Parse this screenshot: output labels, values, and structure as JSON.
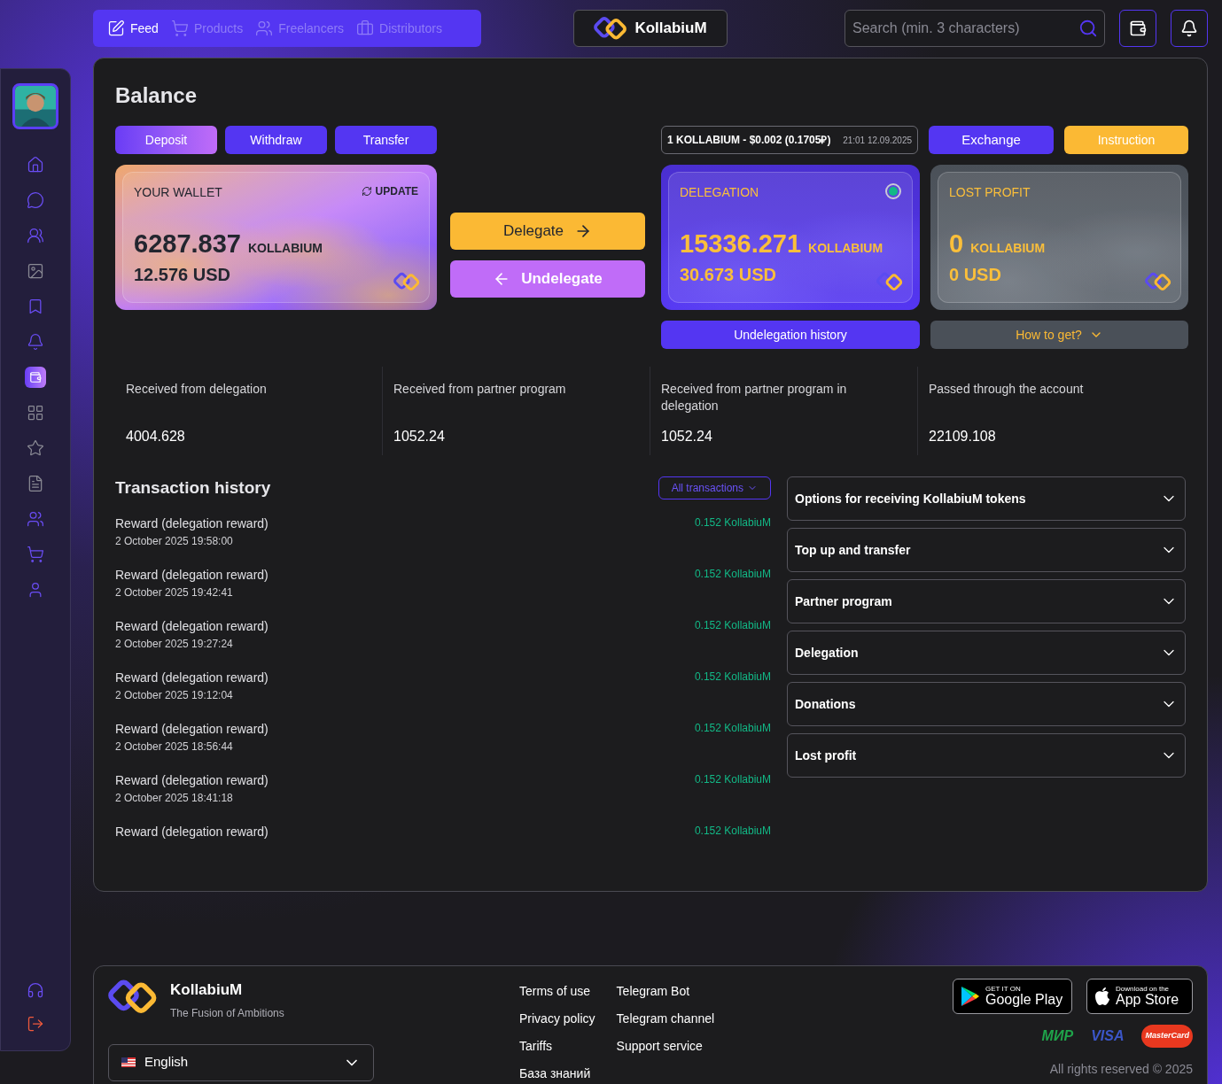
{
  "nav": {
    "tabs": [
      {
        "label": "Feed",
        "selected": true
      },
      {
        "label": "Products",
        "selected": false
      },
      {
        "label": "Freelancers",
        "selected": false
      },
      {
        "label": "Distributors",
        "selected": false
      }
    ],
    "logo": "KollabiuM",
    "search": {
      "placeholder": "Search (min. 3 characters)"
    }
  },
  "sidebar": {
    "items": [
      {
        "selected": false
      },
      {
        "selected": false
      },
      {
        "selected": false
      },
      {
        "selected": false
      },
      {
        "selected": false
      },
      {
        "selected": false
      },
      {
        "selected": true
      },
      {
        "selected": false
      },
      {
        "selected": false
      },
      {
        "selected": false
      },
      {
        "selected": false
      },
      {
        "selected": false
      },
      {
        "selected": false
      }
    ]
  },
  "balance": {
    "title": "Balance",
    "actions": [
      "Deposit",
      "Withdraw",
      "Transfer"
    ],
    "rate": "1 KOLLABIUM - $0.002 (0.1705₽)",
    "rate_time": "21:01 12.09.2025",
    "exchange": "Exchange",
    "instruction": "Instruction",
    "wallet": {
      "label": "YOUR WALLET",
      "update": "UPDATE",
      "amount": "6287.837",
      "unit": "KOLLABIUM",
      "usd": "12.576 USD"
    },
    "delegate": "Delegate",
    "undelegate": "Undelegate",
    "delegation": {
      "label": "DELEGATION",
      "active": true,
      "amount": "15336.271",
      "unit": "KOLLABIUM",
      "usd": "30.673 USD",
      "history": "Undelegation history"
    },
    "lost_profit": {
      "label": "LOST PROFIT",
      "amount": "0",
      "unit": "KOLLABIUM",
      "usd": "0 USD",
      "how": "How to get?"
    },
    "stats": [
      {
        "label": "Received from delegation",
        "value": "4004.628"
      },
      {
        "label": "Received from partner program",
        "value": "1052.24"
      },
      {
        "label": "Received from partner program in delegation",
        "value": "1052.24"
      },
      {
        "label": "Passed through the account",
        "value": "22109.108"
      }
    ]
  },
  "transactions": {
    "title": "Transaction history",
    "filter": "All transactions",
    "rows": [
      {
        "title": "Reward (delegation reward)",
        "date": "2 October 2025 19:58:00",
        "amount": "0.152 KollabiuM"
      },
      {
        "title": "Reward (delegation reward)",
        "date": "2 October 2025 19:42:41",
        "amount": "0.152 KollabiuM"
      },
      {
        "title": "Reward (delegation reward)",
        "date": "2 October 2025 19:27:24",
        "amount": "0.152 KollabiuM"
      },
      {
        "title": "Reward (delegation reward)",
        "date": "2 October 2025 19:12:04",
        "amount": "0.152 KollabiuM"
      },
      {
        "title": "Reward (delegation reward)",
        "date": "2 October 2025 18:56:44",
        "amount": "0.152 KollabiuM"
      },
      {
        "title": "Reward (delegation reward)",
        "date": "2 October 2025 18:41:18",
        "amount": "0.152 KollabiuM"
      },
      {
        "title": "Reward (delegation reward)",
        "amount": "0.152 KollabiuM"
      }
    ]
  },
  "faq": [
    {
      "title": "Options for receiving KollabiuM tokens",
      "expanded": false
    },
    {
      "title": "Top up and transfer",
      "expanded": false
    },
    {
      "title": "Partner program",
      "expanded": false
    },
    {
      "title": "Delegation",
      "expanded": false
    },
    {
      "title": "Donations",
      "expanded": false
    },
    {
      "title": "Lost profit",
      "expanded": false
    }
  ],
  "footer": {
    "brand": "KollabiuM",
    "tagline": "The Fusion of Ambitions",
    "language": "English",
    "links_1": [
      "Terms of use",
      "Privacy policy",
      "Tariffs",
      "База знаний"
    ],
    "links_2": [
      "Telegram Bot",
      "Telegram channel",
      "Support service"
    ],
    "google": {
      "small": "GET IT ON",
      "big": "Google Play"
    },
    "apple": {
      "small": "Download on the",
      "big": "App Store"
    },
    "payments": [
      {
        "label": "МИР",
        "color": "#1fa34a"
      },
      {
        "label": "VISA",
        "color": "#3b56c8"
      },
      {
        "label": "MasterCard",
        "color": "#e8381f"
      }
    ],
    "copyright": "All rights reserved © 2025"
  }
}
